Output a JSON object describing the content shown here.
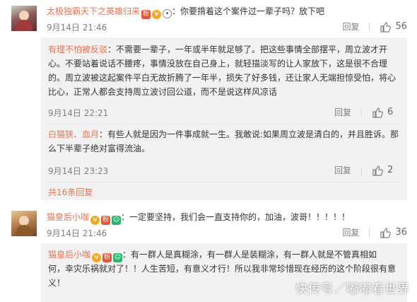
{
  "comments": [
    {
      "user": "太极独霸天下之英雄归来",
      "text": "：你要揹着这个案件过一辈子吗？放下吧",
      "time": "9月14日 21:46",
      "reply_label": "回复",
      "likes": "56",
      "sub_replies": [
        {
          "user": "有理不怕被反驳",
          "lines": [
            "：不需要一辈子，一年或半年就足够了。把这些事情全部摆平，周立波才开",
            "心。不要站着说话不腰疼，事情没放在自己身上，就轻描淡写的让人家放下，这是很不合理",
            "的。周立波被这起案件平白无故折腾了一年半，损失了好多钱，还让家人无端担惊受怕，将心",
            "比心，正常人都会支持周立波讨回公道，而不是说这样风凉话"
          ],
          "time": "9月14日 22:21",
          "reply_label": "回复",
          "likes": "6"
        },
        {
          "user": "白猫狭、血月",
          "lines": [
            "：有些人就是因为一件事成就一生。我敢说:如果周立波是清白的，并且胜诉。那",
            "么下半辈子绝对富得流油。"
          ],
          "time": "9月14日 23:23",
          "reply_label": "回复",
          "likes": "2"
        }
      ],
      "more_replies": "共16条回复"
    },
    {
      "user": "猫皇后小咖",
      "text": "：一定要坚持，我们会一直支持你的，加油，波哥！！！！！",
      "time": "9月14日 21:46",
      "reply_label": "回复",
      "likes": "36",
      "sub_replies": [
        {
          "user": "猫皇后小咖",
          "lines": [
            "：有一群人是真糊涂，有一群人是装糊涂，有一群人就是不管真相如",
            "何，幸灾乐祸就对了！！人生苦短，有意义才行！所以我非常珍惜现在经历的这个阶段很有意",
            "义！"
          ]
        }
      ]
    }
  ],
  "watermark": "快传号／嘟嘟看世界",
  "colors": {
    "username": "#eb7350",
    "text": "#333333",
    "meta": "#808080",
    "sub_bg": "#f2f2f2"
  }
}
